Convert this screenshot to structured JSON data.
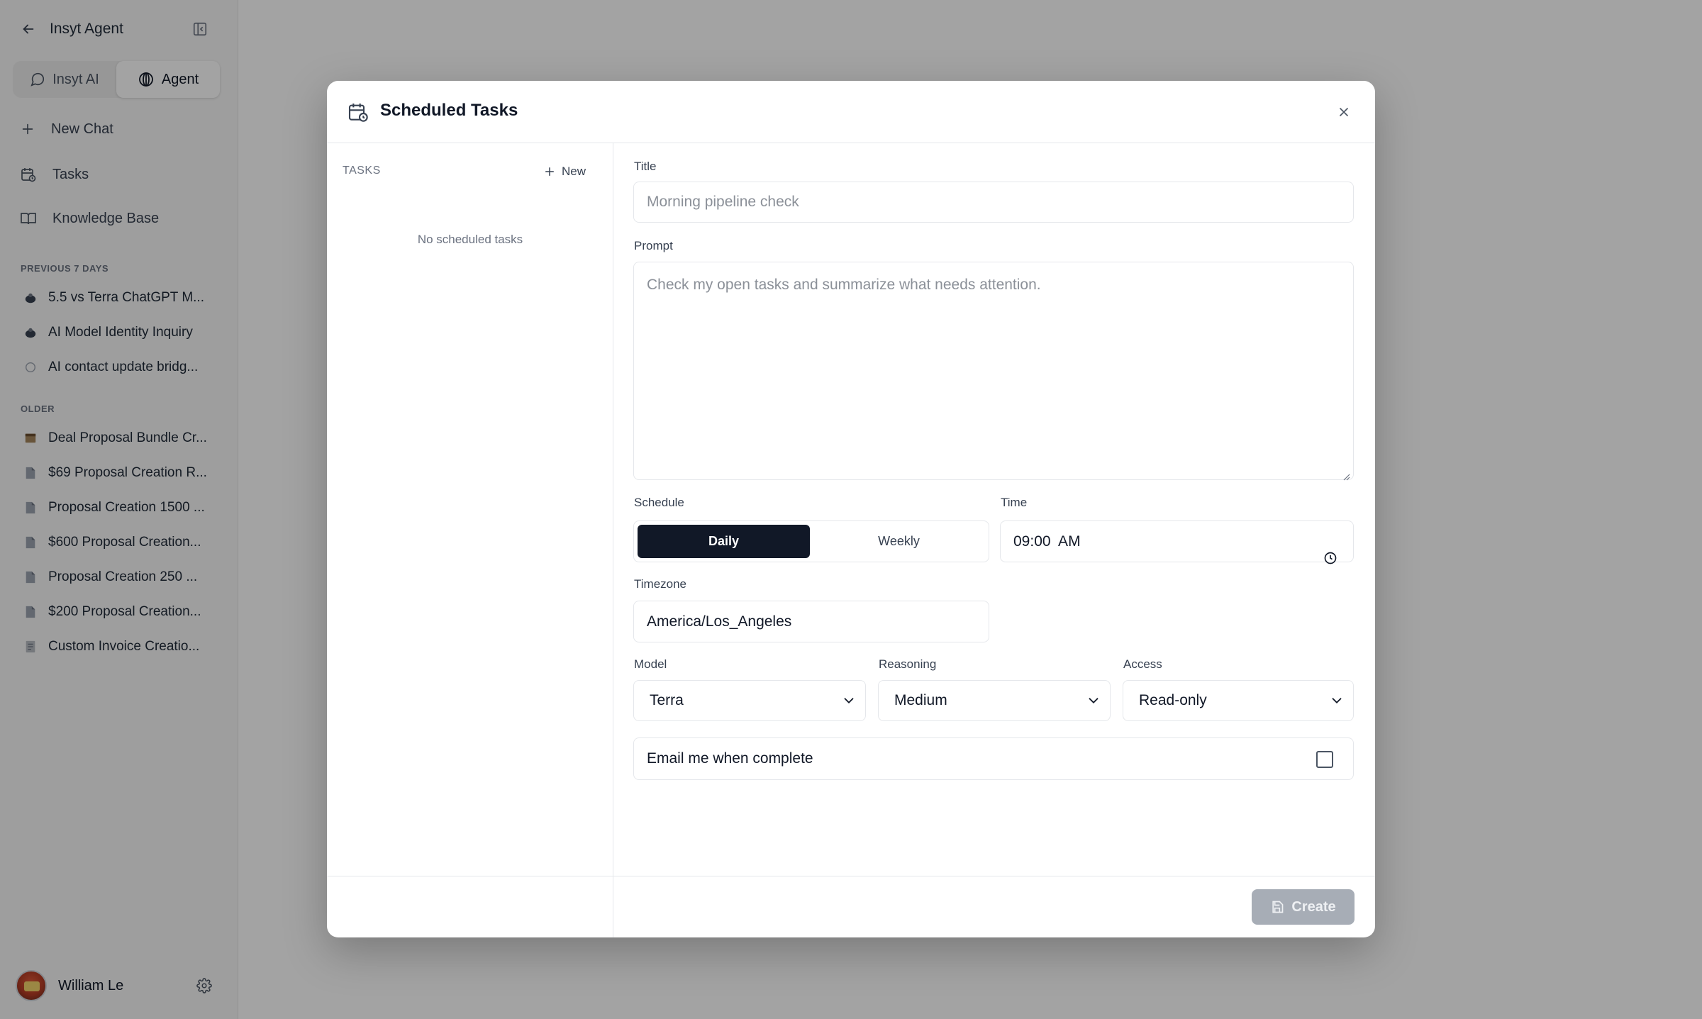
{
  "sidebar": {
    "app_title": "Insyt Agent",
    "modes": [
      {
        "label": "Insyt AI",
        "icon": "chat-bubble-icon",
        "active": false
      },
      {
        "label": "Agent",
        "icon": "agent-icon",
        "active": true
      }
    ],
    "nav": [
      {
        "label": "New Chat",
        "icon": "plus-icon"
      },
      {
        "label": "Tasks",
        "icon": "calendar-clock-icon"
      },
      {
        "label": "Knowledge Base",
        "icon": "book-icon"
      }
    ],
    "section_recent": "PREVIOUS 7 DAYS",
    "recent_chats": [
      {
        "label": "5.5 vs Terra ChatGPT M..."
      },
      {
        "label": "AI Model Identity Inquiry"
      },
      {
        "label": "AI contact update bridg..."
      }
    ],
    "section_older": "OLDER",
    "older_chats": [
      {
        "label": "Deal Proposal Bundle Cr..."
      },
      {
        "label": "$69 Proposal Creation R..."
      },
      {
        "label": "Proposal Creation 1500 ..."
      },
      {
        "label": "$600 Proposal Creation..."
      },
      {
        "label": "Proposal Creation 250 ..."
      },
      {
        "label": "$200 Proposal Creation..."
      },
      {
        "label": "Custom Invoice Creatio..."
      }
    ],
    "user": {
      "name": "William Le"
    }
  },
  "modal": {
    "title": "Scheduled Tasks",
    "tasks_label": "TASKS",
    "new_label": "New",
    "empty_message": "No scheduled tasks",
    "form": {
      "title_label": "Title",
      "title_placeholder": "Morning pipeline check",
      "prompt_label": "Prompt",
      "prompt_placeholder": "Check my open tasks and summarize what needs attention.",
      "schedule_label": "Schedule",
      "schedule_options": [
        "Daily",
        "Weekly"
      ],
      "schedule_selected": "Daily",
      "time_label": "Time",
      "time_value": "09:00  AM",
      "timezone_label": "Timezone",
      "timezone_value": "America/Los_Angeles",
      "model_label": "Model",
      "model_value": "Terra",
      "reasoning_label": "Reasoning",
      "reasoning_value": "Medium",
      "access_label": "Access",
      "access_value": "Read-only",
      "email_label": "Email me when complete",
      "email_checked": false
    },
    "create_label": "Create"
  },
  "colors": {
    "accent_dark": "#111827",
    "disabled_button": "#a7adb6",
    "overlay": "rgba(0,0,0,0.36)"
  }
}
